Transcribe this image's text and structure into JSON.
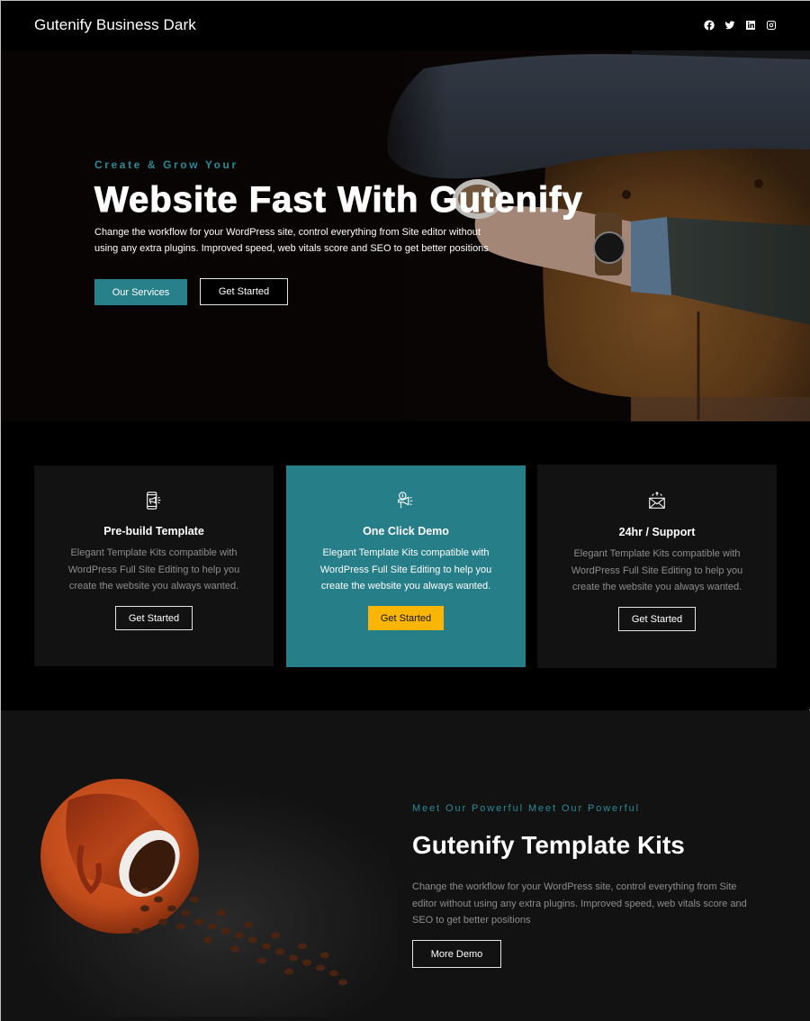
{
  "header": {
    "site_title": "Gutenify Business Dark",
    "social_icons": [
      "facebook-icon",
      "twitter-icon",
      "linkedin-icon",
      "instagram-icon"
    ]
  },
  "hero": {
    "kicker": "Create & Grow Your",
    "title": "Website Fast With Gutenify",
    "description": "Change the workflow for your WordPress site, control everything from Site editor without using any extra plugins. Improved speed, web vitals score and SEO to get better positions",
    "primary_button": "Our Services",
    "secondary_button": "Get Started",
    "image_alt": "Man sitting on brown leather chesterfield sofa holding a cup of coffee"
  },
  "features": {
    "cards": [
      {
        "icon": "mobile-megaphone-icon",
        "title": "Pre-build Template",
        "description": "Elegant Template Kits compatible with WordPress Full Site Editing to help you create the website you always wanted.",
        "button": "Get Started"
      },
      {
        "icon": "megaphone-bulb-icon",
        "title": "One Click Demo",
        "description": "Elegant Template Kits compatible with WordPress Full Site Editing to help you create the website you always wanted.",
        "button": "Get Started"
      },
      {
        "icon": "envelope-arrows-icon",
        "title": "24hr / Support",
        "description": "Elegant Template Kits compatible with WordPress Full Site Editing to help you create the website you always wanted.",
        "button": "Get Started"
      }
    ]
  },
  "kits": {
    "kicker": "Meet Our Powerful Meet Our Powerful",
    "title": "Gutenify Template Kits",
    "description": "Change the workflow for your WordPress site, control everything from Site editor without using any extra plugins. Improved speed, web vitals score and SEO to get better positions",
    "button": "More Demo",
    "image_alt": "Orange coffee cup tipped over on saucer with spilled coffee beans"
  },
  "colors": {
    "accent_teal": "#267e89",
    "kicker_teal": "#2a8a96",
    "button_yellow": "#fbb605",
    "background": "#000000",
    "card_background": "#121212"
  }
}
